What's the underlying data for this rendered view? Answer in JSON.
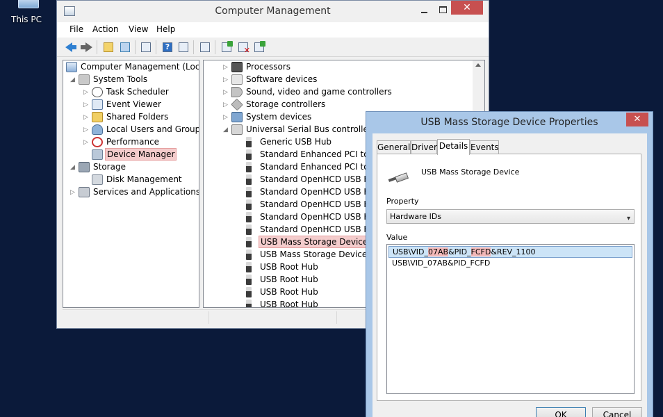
{
  "desktop": {
    "icon_label": "This PC"
  },
  "window": {
    "title": "Computer Management",
    "menu": [
      "File",
      "Action",
      "View",
      "Help"
    ]
  },
  "left_tree": [
    {
      "label": "Computer Management (Local)",
      "icon": "computer-icon",
      "expander": ""
    },
    {
      "label": "System Tools",
      "icon": "tools-icon",
      "expander": "◢"
    },
    {
      "label": "Task Scheduler",
      "icon": "clock-icon",
      "expander": "▷"
    },
    {
      "label": "Event Viewer",
      "icon": "event-viewer-icon",
      "expander": "▷"
    },
    {
      "label": "Shared Folders",
      "icon": "folder-icon",
      "expander": "▷"
    },
    {
      "label": "Local Users and Groups",
      "icon": "users-icon",
      "expander": "▷"
    },
    {
      "label": "Performance",
      "icon": "performance-icon",
      "expander": "▷"
    },
    {
      "label": "Device Manager",
      "icon": "device-manager-icon",
      "expander": ""
    },
    {
      "label": "Storage",
      "icon": "storage-icon",
      "expander": "◢"
    },
    {
      "label": "Disk Management",
      "icon": "disk-icon",
      "expander": ""
    },
    {
      "label": "Services and Applications",
      "icon": "services-icon",
      "expander": "▷"
    }
  ],
  "device_tree": [
    {
      "label": "Processors",
      "icon": "processor-icon",
      "expander": "▷"
    },
    {
      "label": "Software devices",
      "icon": "software-device-icon",
      "expander": "▷"
    },
    {
      "label": "Sound, video and game controllers",
      "icon": "sound-icon",
      "expander": "▷"
    },
    {
      "label": "Storage controllers",
      "icon": "storage-controller-icon",
      "expander": "▷"
    },
    {
      "label": "System devices",
      "icon": "system-device-icon",
      "expander": "▷"
    },
    {
      "label": "Universal Serial Bus controllers",
      "icon": "usb-controller-icon",
      "expander": "◢"
    },
    {
      "label": "Generic USB Hub",
      "icon": "usb-plug-icon",
      "expander": ""
    },
    {
      "label": "Standard Enhanced PCI to USB Host Controller",
      "icon": "usb-plug-icon",
      "expander": ""
    },
    {
      "label": "Standard Enhanced PCI to USB Host Controller",
      "icon": "usb-plug-icon",
      "expander": ""
    },
    {
      "label": "Standard OpenHCD USB Host Controller",
      "icon": "usb-plug-icon",
      "expander": ""
    },
    {
      "label": "Standard OpenHCD USB Host Controller",
      "icon": "usb-plug-icon",
      "expander": ""
    },
    {
      "label": "Standard OpenHCD USB Host Controller",
      "icon": "usb-plug-icon",
      "expander": ""
    },
    {
      "label": "Standard OpenHCD USB Host Controller",
      "icon": "usb-plug-icon",
      "expander": ""
    },
    {
      "label": "Standard OpenHCD USB Host Controller",
      "icon": "usb-plug-icon",
      "expander": ""
    },
    {
      "label": "USB Mass Storage Device",
      "icon": "usb-plug-icon",
      "expander": ""
    },
    {
      "label": "USB Mass Storage Device",
      "icon": "usb-plug-icon",
      "expander": ""
    },
    {
      "label": "USB Root Hub",
      "icon": "usb-plug-icon",
      "expander": ""
    },
    {
      "label": "USB Root Hub",
      "icon": "usb-plug-icon",
      "expander": ""
    },
    {
      "label": "USB Root Hub",
      "icon": "usb-plug-icon",
      "expander": ""
    },
    {
      "label": "USB Root Hub",
      "icon": "usb-plug-icon",
      "expander": ""
    }
  ],
  "dialog": {
    "title": "USB Mass Storage Device Properties",
    "close": "✕",
    "tabs": [
      "General",
      "Driver",
      "Details",
      "Events"
    ],
    "active_tab": "Details",
    "device_name": "USB Mass Storage Device",
    "property_label": "Property",
    "property_value": "Hardware IDs",
    "value_label": "Value",
    "values": [
      {
        "pre": "USB\\VID_",
        "hl1": "07AB",
        "mid": "&PID_",
        "hl2": "FCFD",
        "post": "&REV_1100"
      },
      {
        "pre": "USB\\VID_07AB&PID_FCFD",
        "hl1": "",
        "mid": "",
        "hl2": "",
        "post": ""
      }
    ],
    "ok_label": "OK",
    "cancel_label": "Cancel"
  },
  "colors": {
    "desktop": "#0b1a3a",
    "selection_highlight": "#f4cccc",
    "close_button": "#c75050"
  }
}
